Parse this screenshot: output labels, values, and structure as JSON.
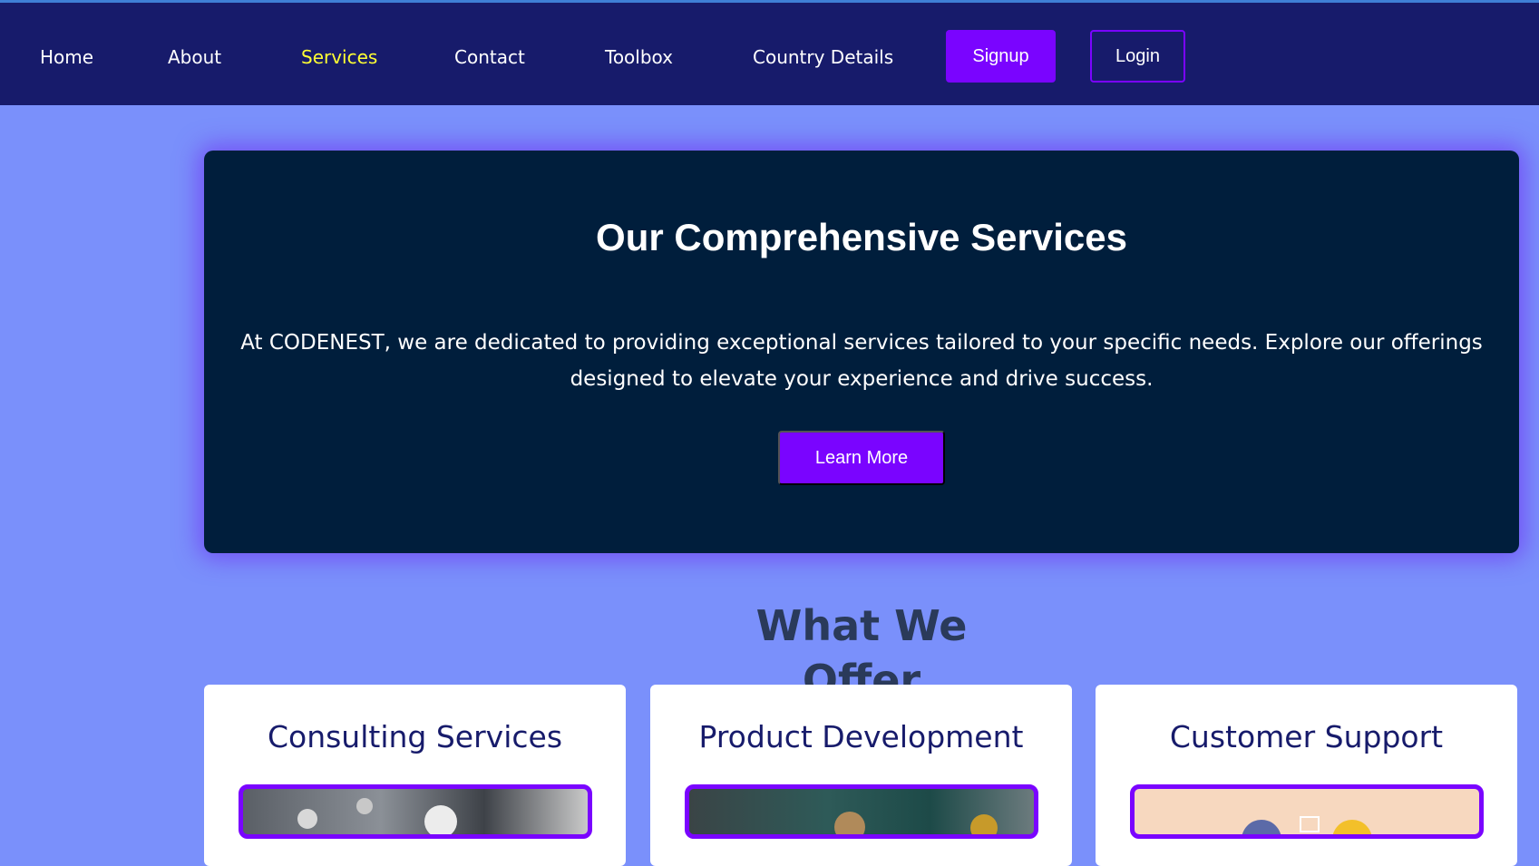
{
  "nav": {
    "items": [
      {
        "label": "Home",
        "active": false
      },
      {
        "label": "About",
        "active": false
      },
      {
        "label": "Services",
        "active": true
      },
      {
        "label": "Contact",
        "active": false
      },
      {
        "label": "Toolbox",
        "active": false
      },
      {
        "label": "Country Details",
        "active": false
      }
    ],
    "signup_label": "Signup",
    "login_label": "Login"
  },
  "hero": {
    "title": "Our Comprehensive Services",
    "description": "At CODENEST, we are dedicated to providing exceptional services tailored to your specific needs. Explore our offerings designed to elevate your experience and drive success.",
    "button_label": "Learn More"
  },
  "offer": {
    "title": "What We Offer",
    "cards": [
      {
        "title": "Consulting Services"
      },
      {
        "title": "Product Development"
      },
      {
        "title": "Customer Support"
      }
    ]
  },
  "colors": {
    "navbar": "#171b6b",
    "background": "#7a90fb",
    "accent": "#7a04ff",
    "active_link": "#ffff33",
    "hero": "#001e3c"
  }
}
